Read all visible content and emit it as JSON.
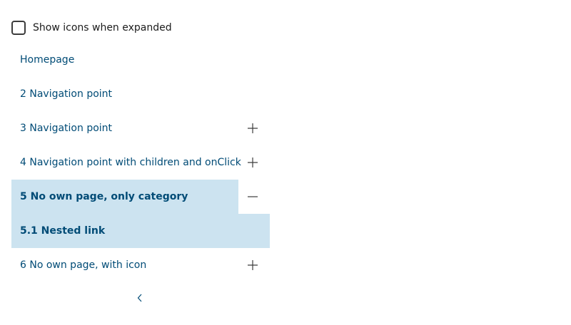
{
  "checkbox": {
    "label": "Show icons when expanded",
    "checked": false
  },
  "nav": {
    "items": [
      {
        "label": "Homepage",
        "expandable": false
      },
      {
        "label": "2 Navigation point",
        "expandable": false
      },
      {
        "label": "3 Navigation point",
        "expandable": true,
        "toggle_icon": "plus-icon"
      },
      {
        "label": "4 Navigation point with children and onClick",
        "expandable": true,
        "toggle_icon": "plus-icon"
      },
      {
        "label": "5 No own page, only category",
        "expandable": true,
        "expanded": true,
        "active": true,
        "toggle_icon": "minus-icon"
      },
      {
        "label": "5.1 Nested link",
        "nested": true,
        "active": true
      },
      {
        "label": "6 No own page, with icon",
        "expandable": true,
        "toggle_icon": "plus-icon"
      }
    ]
  },
  "collapse_icon": "chevron-left-icon",
  "colors": {
    "link": "#004b76",
    "active_bg": "#cce3f0",
    "accent": "#004b76",
    "icon": "#3c3c3c"
  }
}
